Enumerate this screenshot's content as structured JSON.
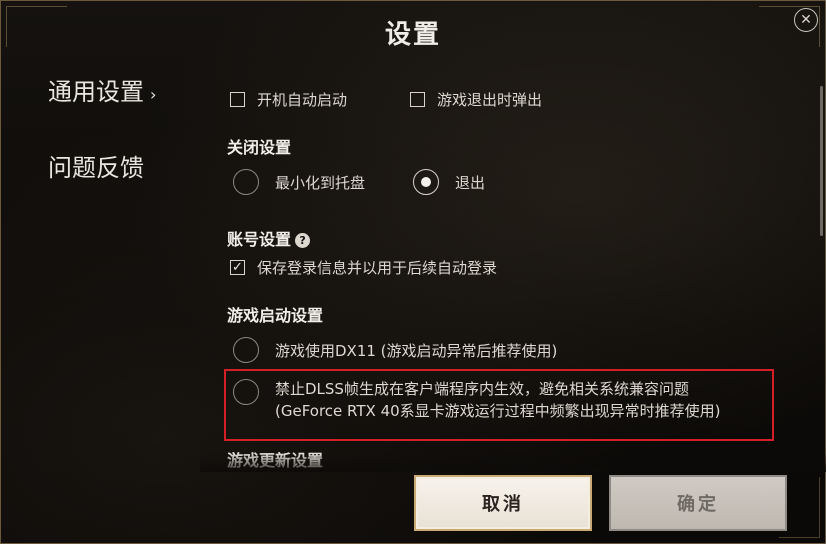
{
  "window": {
    "title": "设置"
  },
  "sidebar": {
    "items": [
      {
        "label": "通用设置",
        "active": true
      },
      {
        "label": "问题反馈",
        "active": false
      }
    ]
  },
  "general": {
    "checkbox_autostart": {
      "label": "开机自动启动",
      "checked": false
    },
    "checkbox_popup_on_exit": {
      "label": "游戏退出时弹出",
      "checked": false
    }
  },
  "close_settings": {
    "title": "关闭设置",
    "options": [
      {
        "label": "最小化到托盘",
        "selected": false
      },
      {
        "label": "退出",
        "selected": true
      }
    ]
  },
  "account_settings": {
    "title": "账号设置",
    "help_icon": "?",
    "checkbox_save_login": {
      "label": "保存登录信息并以用于后续自动登录",
      "checked": true
    }
  },
  "launch_settings": {
    "title": "游戏启动设置",
    "option_dx11": {
      "label": "游戏使用DX11 (游戏启动异常后推荐使用)",
      "selected": false
    },
    "option_dlss": {
      "line1": "禁止DLSS帧生成在客户端程序内生效，避免相关系统兼容问题",
      "line2": "(GeForce RTX 40系显卡游戏运行过程中频繁出现异常时推荐使用)",
      "selected": false
    }
  },
  "update_settings": {
    "title": "游戏更新设置"
  },
  "buttons": {
    "cancel": "取消",
    "confirm": "确定"
  },
  "colors": {
    "highlight": "#d41f26",
    "accent_gold": "#c9aa73",
    "background": "#0d0b09"
  }
}
